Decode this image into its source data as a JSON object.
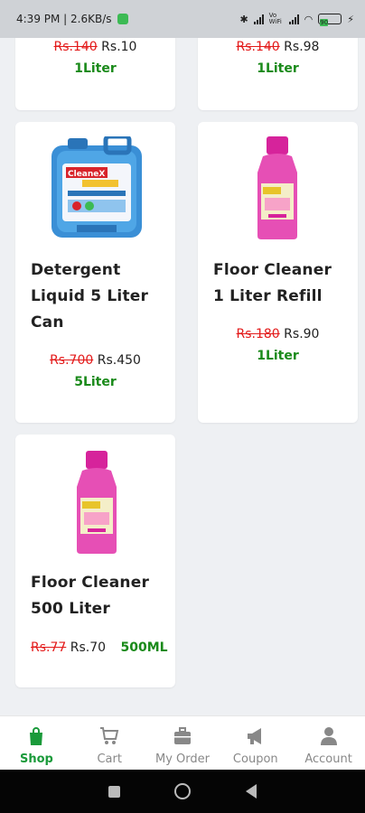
{
  "status_bar": {
    "time_info": "4:39 PM | 2.6KB/s",
    "network_label": "Vo WiFi",
    "battery_level": "90"
  },
  "products_top": [
    {
      "old_price": "Rs.140",
      "new_price": "Rs.10",
      "quantity": "1Liter"
    },
    {
      "old_price": "Rs.140",
      "new_price": "Rs.98",
      "quantity": "1Liter"
    }
  ],
  "products": [
    {
      "title": "Detergent Liquid 5 Liter Can",
      "old_price": "Rs.700",
      "new_price": "Rs.450",
      "quantity": "5Liter",
      "image": "detergent-can-image"
    },
    {
      "title": "Floor Cleaner 1 Liter Refill",
      "old_price": "Rs.180",
      "new_price": "Rs.90",
      "quantity": "1Liter",
      "image": "floor-cleaner-bottle-image"
    },
    {
      "title": "Floor Cleaner 500 Liter",
      "old_price": "Rs.77",
      "new_price": "Rs.70",
      "quantity": "500ML",
      "image": "floor-cleaner-bottle-image"
    }
  ],
  "bottom_nav": {
    "items": [
      {
        "label": "Shop",
        "icon": "shopping-bag-icon",
        "active": true
      },
      {
        "label": "Cart",
        "icon": "cart-icon",
        "active": false
      },
      {
        "label": "My Order",
        "icon": "briefcase-icon",
        "active": false
      },
      {
        "label": "Coupon",
        "icon": "megaphone-icon",
        "active": false
      },
      {
        "label": "Account",
        "icon": "person-icon",
        "active": false
      }
    ]
  },
  "colors": {
    "accent": "#1a9a3a",
    "old_price": "#e31b1b",
    "quantity": "#1a8a1a",
    "background": "#eef0f3"
  }
}
